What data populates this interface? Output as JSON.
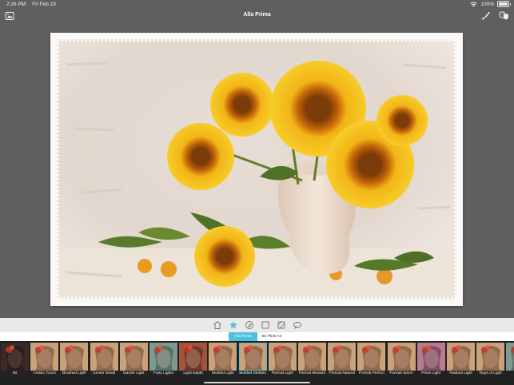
{
  "status_bar": {
    "time": "2:26 PM",
    "date": "Fri Feb 23",
    "battery": "100%",
    "icons": [
      "wifi-icon",
      "battery-icon"
    ]
  },
  "nav_bar": {
    "title": "Alla Prima",
    "left_icon": "gallery-icon",
    "right_icons": [
      "brush-icon",
      "masks-icon"
    ]
  },
  "toolbar": {
    "icons": [
      "home-icon",
      "star-icon",
      "palette-icon",
      "frame-icon",
      "texture-icon",
      "speech-bubble-icon"
    ],
    "active": "star-icon",
    "accent": "#4ec1de"
  },
  "tabs": [
    {
      "label": "Alla Prima",
      "active": true
    },
    {
      "label": "En Plein Air",
      "active": false
    }
  ],
  "filmstrip": {
    "items": [
      {
        "label": "00",
        "tone": "dark"
      },
      {
        "label": "Artistic Touch",
        "tone": "warm"
      },
      {
        "label": "Brushed Light",
        "tone": "warm"
      },
      {
        "label": "Center Detail",
        "tone": "warm"
      },
      {
        "label": "Dazzle Light",
        "tone": "warm"
      },
      {
        "label": "Fairy Lights",
        "tone": "cool"
      },
      {
        "label": "Light Depth",
        "tone": "red"
      },
      {
        "label": "Mottled Light",
        "tone": "warm"
      },
      {
        "label": "Mottled Strokes",
        "tone": "warm",
        "selected": true
      },
      {
        "label": "Portrait Light",
        "tone": "warm"
      },
      {
        "label": "Portrait Medium",
        "tone": "warm"
      },
      {
        "label": "Portrait Natural",
        "tone": "warm"
      },
      {
        "label": "Portrait Perfect",
        "tone": "warm"
      },
      {
        "label": "Portrait Warm",
        "tone": "warm"
      },
      {
        "label": "Prism Light",
        "tone": "pink"
      },
      {
        "label": "Radiant Light",
        "tone": "warm"
      },
      {
        "label": "Rays of Light",
        "tone": "warm"
      },
      {
        "label": "R",
        "tone": "cool"
      }
    ]
  }
}
